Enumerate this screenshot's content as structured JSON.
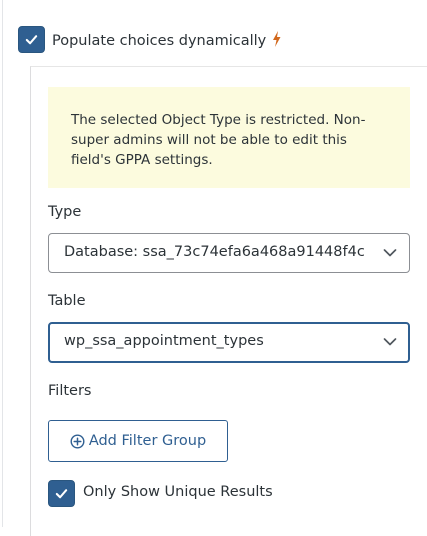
{
  "populate": {
    "label": "Populate choices dynamically",
    "checked": true,
    "bolt_icon": "lightning-bolt-icon",
    "bolt_color": "#d2691e"
  },
  "notice": {
    "text": "The selected Object Type is restricted. Non-super admins will not be able to edit this field's GPPA settings."
  },
  "type_field": {
    "label": "Type",
    "value": "Database: ssa_73c74efa6a468a91448f4c"
  },
  "table_field": {
    "label": "Table",
    "value": "wp_ssa_appointment_types"
  },
  "filters": {
    "label": "Filters",
    "add_button": "Add Filter Group"
  },
  "unique": {
    "label": "Only Show Unique Results",
    "checked": true
  },
  "colors": {
    "accent": "#2f5f91",
    "notice_bg": "#fcfbde"
  }
}
